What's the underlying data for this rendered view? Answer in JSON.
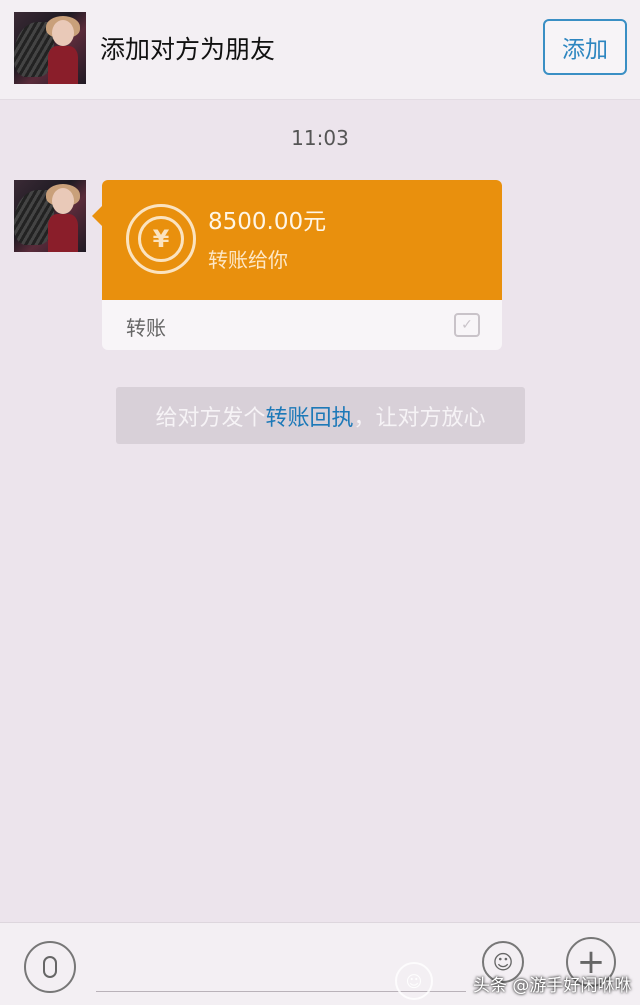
{
  "header": {
    "title": "添加对方为朋友",
    "add_label": "添加"
  },
  "chat": {
    "time": "11:03",
    "transfer": {
      "amount": "8500.00元",
      "subtitle": "转账给你",
      "footer_label": "转账",
      "icon": "transfer-yuan-icon",
      "accent_color": "#e9900d"
    },
    "receipt_tip": {
      "prefix": "给对方发个",
      "link": "转账回执",
      "suffix": "，让对方放心"
    }
  },
  "bottom_bar": {
    "voice_icon": "microphone-icon",
    "emoji_icon": "smiley-icon",
    "more_icon": "plus-icon"
  },
  "watermark": {
    "text": "头条 @游手好闲咻咻"
  }
}
